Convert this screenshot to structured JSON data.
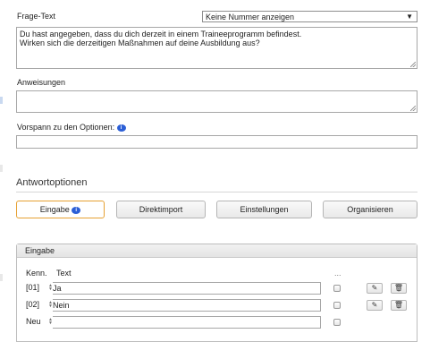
{
  "question": {
    "label": "Frage-Text",
    "numbering_select": "Keine Nummer anzeigen",
    "text_line1": "Du hast angegeben, dass du dich derzeit in einem Traineeprogramm befindest.",
    "text_line2": "Wirken sich die derzeitigen Maßnahmen auf deine Ausbildung aus?"
  },
  "instructions": {
    "label": "Anweisungen",
    "value": ""
  },
  "options_intro": {
    "label": "Vorspann zu den Optionen:",
    "value": ""
  },
  "answer_options": {
    "title": "Antwortoptionen",
    "tabs": [
      {
        "label": "Eingabe"
      },
      {
        "label": "Direktimport"
      },
      {
        "label": "Einstellungen"
      },
      {
        "label": "Organisieren"
      }
    ]
  },
  "panel": {
    "title": "Eingabe",
    "col_kenn": "Kenn.",
    "col_text": "Text",
    "col_more": "...",
    "rows": [
      {
        "code": "[01]",
        "text": "Ja"
      },
      {
        "code": "[02]",
        "text": "Nein"
      },
      {
        "code": "Neu",
        "text": ""
      }
    ]
  },
  "icons": {
    "info": "info-icon",
    "sort": "sort-handle-icon",
    "edit": "edit-icon",
    "delete": "trash-icon"
  },
  "colors": {
    "active_tab_border": "#e6a133",
    "info_icon": "#2c5fd6"
  }
}
